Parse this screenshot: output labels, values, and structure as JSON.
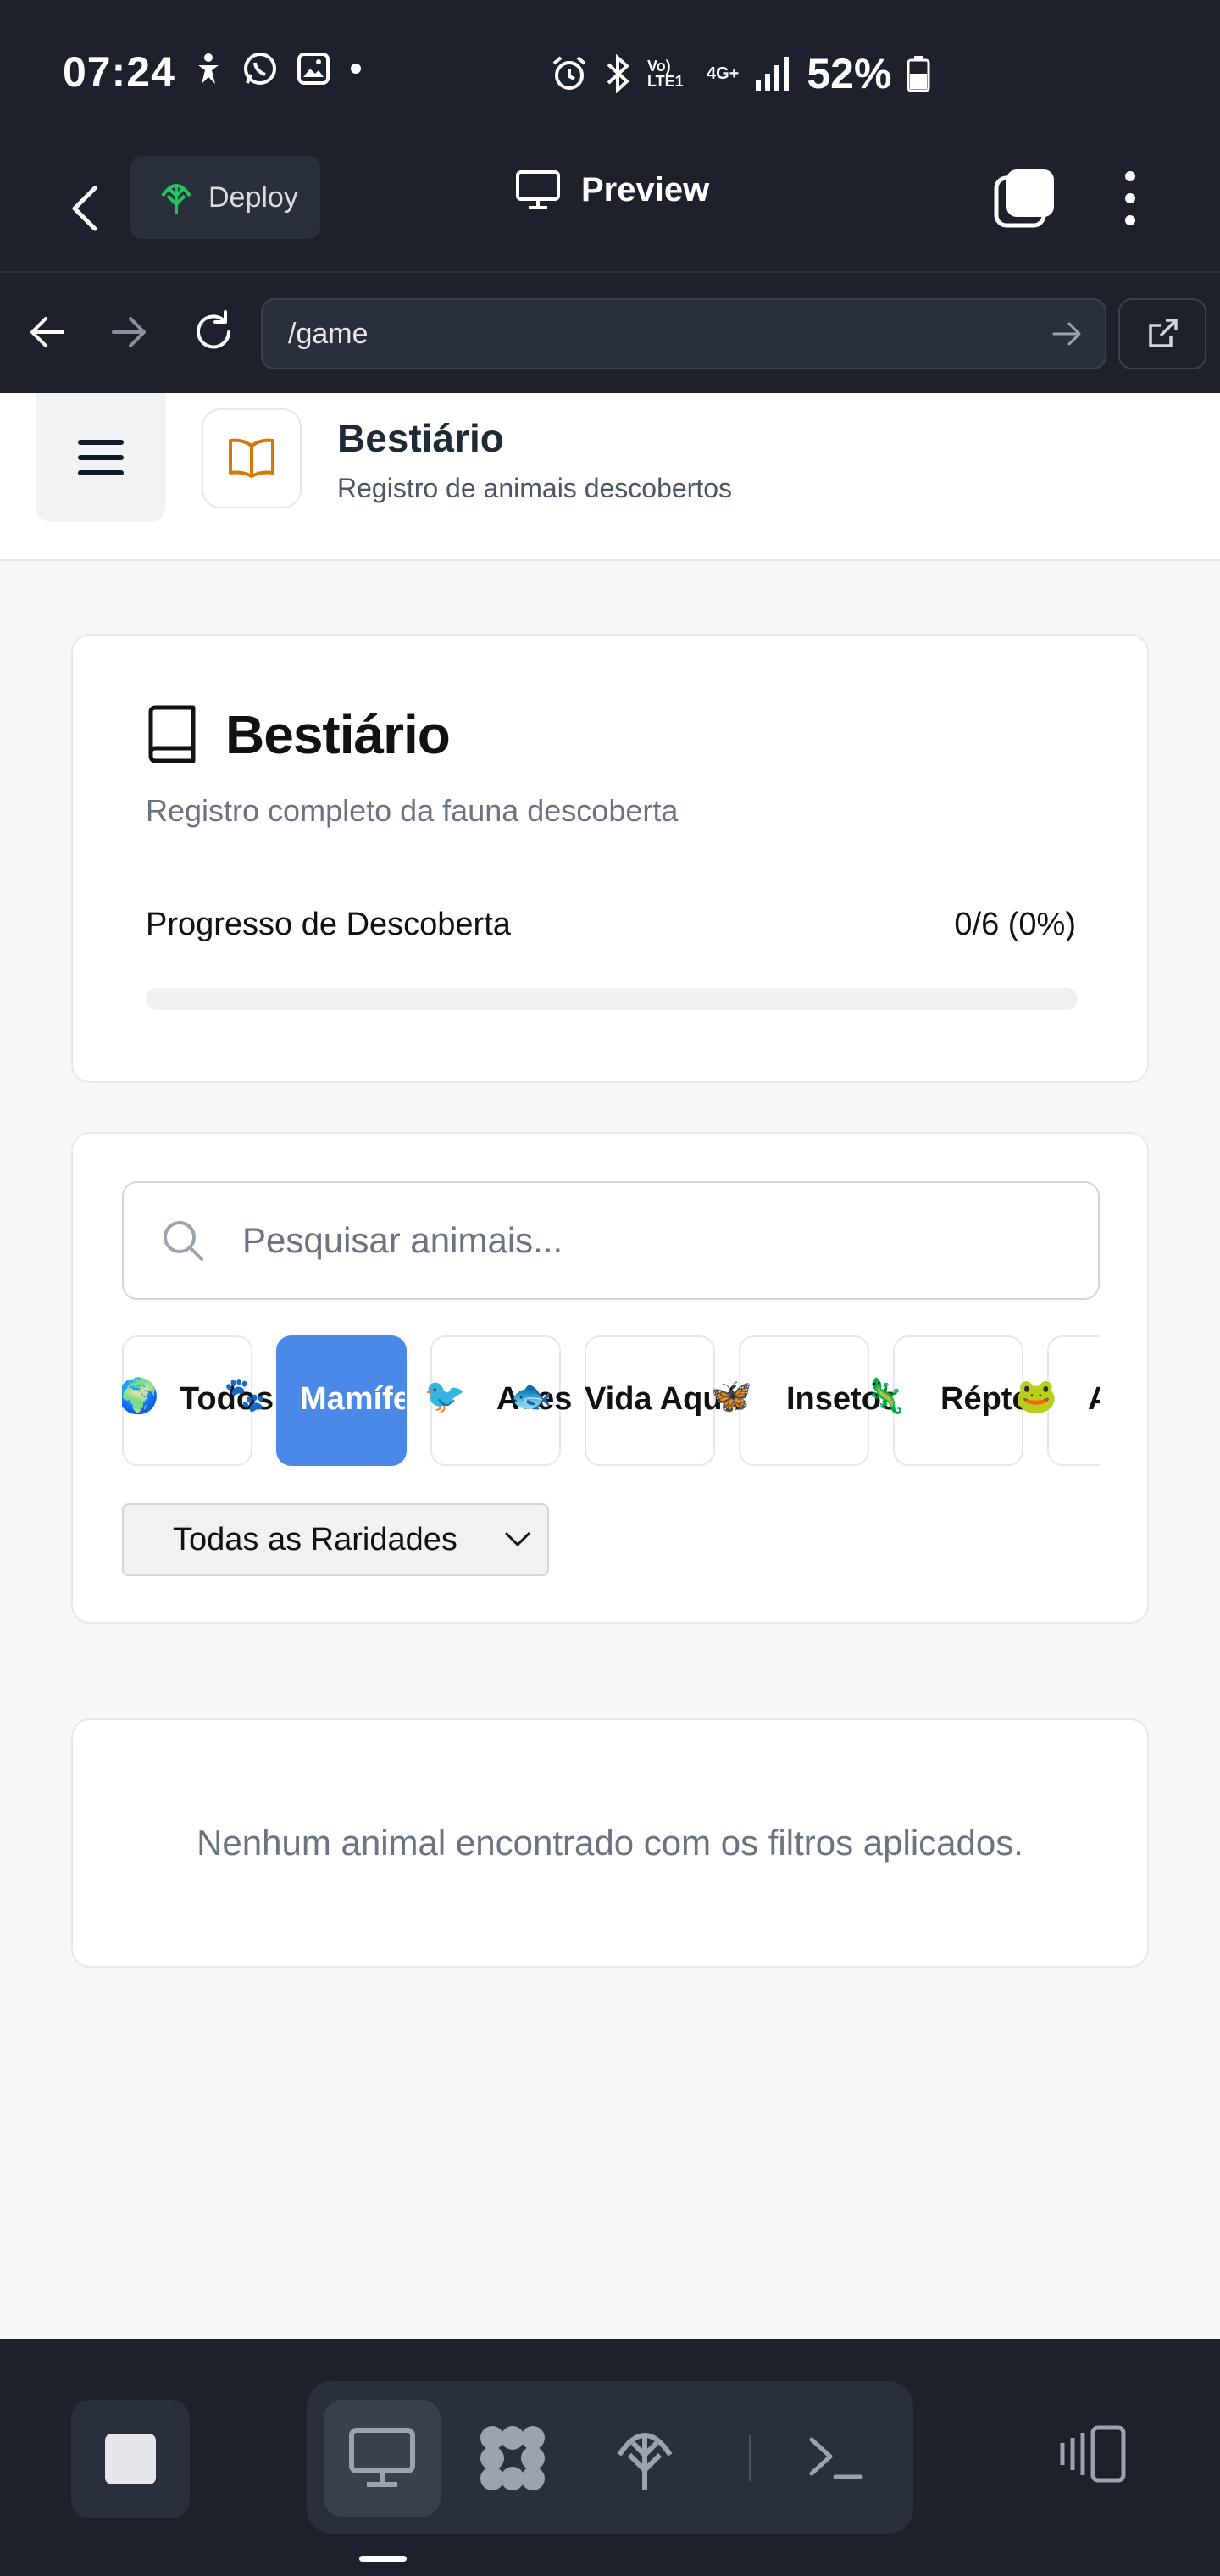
{
  "status_bar": {
    "time": "07:24",
    "network": "Vo) LTE1",
    "network_type": "4G+",
    "battery": "52%"
  },
  "app_bar": {
    "deploy_label": "Deploy",
    "preview_label": "Preview"
  },
  "browser": {
    "url": "/game"
  },
  "web_header": {
    "title": "Bestiário",
    "subtitle": "Registro de animais descobertos"
  },
  "progress_card": {
    "title": "Bestiário",
    "subtitle": "Registro completo da fauna descoberta",
    "progress_label": "Progresso de Descoberta",
    "progress_value": "0/6 (0%)",
    "progress_fraction": 0
  },
  "filters": {
    "search_placeholder": "Pesquisar animais...",
    "categories": [
      {
        "emoji": "🌍",
        "label": "Todos",
        "active": false
      },
      {
        "emoji": "🐾",
        "label": "Mamíferos",
        "active": true
      },
      {
        "emoji": "🐦",
        "label": "Aves",
        "active": false
      },
      {
        "emoji": "🐟",
        "label": "Vida Aquática",
        "active": false
      },
      {
        "emoji": "🦋",
        "label": "Insetos",
        "active": false
      },
      {
        "emoji": "🦎",
        "label": "Répteis",
        "active": false
      },
      {
        "emoji": "🐸",
        "label": "Anfíbios",
        "active": false
      }
    ],
    "rarity_selected": "Todas as Raridades"
  },
  "empty_state": {
    "message": "Nenhum animal encontrado com os filtros aplicados."
  },
  "colors": {
    "accent": "#4a89e8",
    "chrome_bg": "#1c212b",
    "book_icon": "#d97706",
    "deploy_icon": "#22c55e"
  }
}
